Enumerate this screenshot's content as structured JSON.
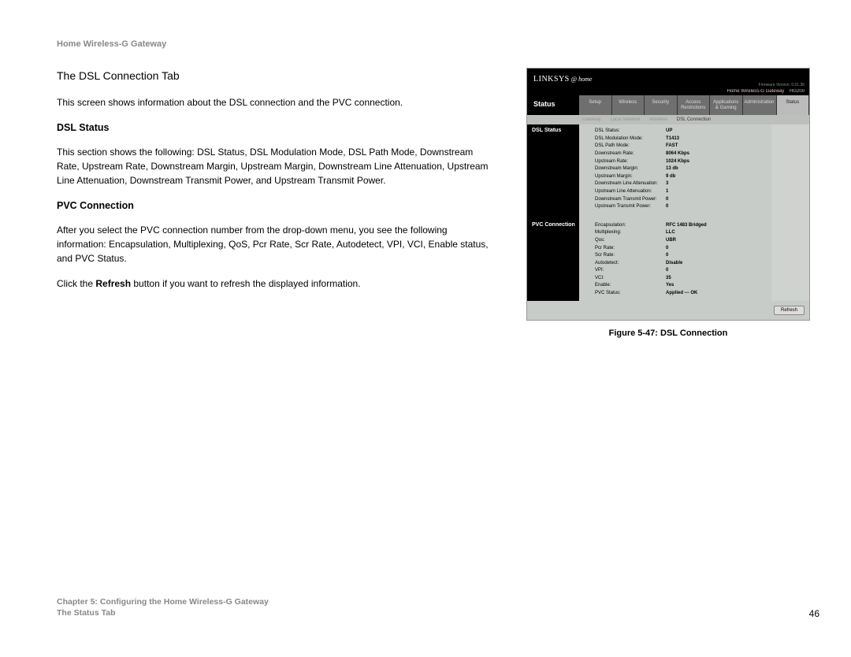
{
  "header": "Home Wireless-G Gateway",
  "title": "The DSL Connection Tab",
  "intro": "This screen shows information about the DSL connection and the PVC connection.",
  "section1_heading": "DSL Status",
  "section1_body": "This section shows the following: DSL Status, DSL Modulation Mode, DSL Path Mode, Downstream Rate, Upstream Rate, Downstream Margin, Upstream Margin, Downstream Line Attenuation, Upstream Line Attenuation, Downstream Transmit Power, and Upstream Transmit Power.",
  "section2_heading": "PVC Connection",
  "section2_body": "After you select the PVC connection number from the drop-down menu, you see the following information: Encapsulation, Multiplexing, QoS, Pcr Rate, Scr Rate, Autodetect, VPI, VCI, Enable status, and PVC Status.",
  "refresh_line_a": "Click the ",
  "refresh_line_b": "Refresh",
  "refresh_line_c": " button if you want to refresh the displayed information.",
  "figure_caption": "Figure 5-47: DSL Connection",
  "footer_chapter": "Chapter 5: Configuring the Home Wireless-G Gateway",
  "footer_sub": "The Status Tab",
  "footer_page": "46",
  "ui": {
    "logo": "LINKSYS",
    "logo_sub": "@ home",
    "firmware": "Firmware Version: 0.01.36",
    "model": "Home Wireless-G Gateway",
    "modelnum": "HG200",
    "status_label": "Status",
    "tabs": [
      "Setup",
      "Wireless",
      "Security",
      "Access\nRestrictions",
      "Applications\n& Gaming",
      "Administration",
      "Status"
    ],
    "subtabs": [
      "Gateway",
      "Local Network",
      "Wireless",
      "DSL Connection"
    ],
    "left1": "DSL Status",
    "left2": "PVC Connection",
    "dsl": [
      {
        "k": "DSL Status:",
        "v": "UP"
      },
      {
        "k": "DSL Modulation Mode:",
        "v": "T1413"
      },
      {
        "k": "DSL Path Mode:",
        "v": "FAST"
      },
      {
        "k": "Downstream Rate:",
        "v": "8064 Kbps"
      },
      {
        "k": "Upstream Rate:",
        "v": "1024 Kbps"
      },
      {
        "k": "Downstream Margin:",
        "v": "13 db"
      },
      {
        "k": "Upstream Margin:",
        "v": "9 db"
      },
      {
        "k": "Downstream Line Attenuation:",
        "v": "3"
      },
      {
        "k": "Upstream Line Attenuation:",
        "v": "1"
      },
      {
        "k": "Downstream Transmit Power:",
        "v": "0"
      },
      {
        "k": "Upstream Transmit Power:",
        "v": "0"
      }
    ],
    "pvc": [
      {
        "k": "Encapsulation:",
        "v": "RFC 1483 Bridged"
      },
      {
        "k": "Multiplexing:",
        "v": "LLC"
      },
      {
        "k": "Qos:",
        "v": "UBR"
      },
      {
        "k": "Pcr Rate:",
        "v": "0"
      },
      {
        "k": "Scr Rate:",
        "v": "0"
      },
      {
        "k": "Autodetect:",
        "v": "Disable"
      },
      {
        "k": "VPI:",
        "v": "0"
      },
      {
        "k": "VCI:",
        "v": "35"
      },
      {
        "k": "Enable:",
        "v": "Yes"
      },
      {
        "k": "PVC Status:",
        "v": "Applied --- OK"
      }
    ],
    "refresh": "Refresh"
  }
}
